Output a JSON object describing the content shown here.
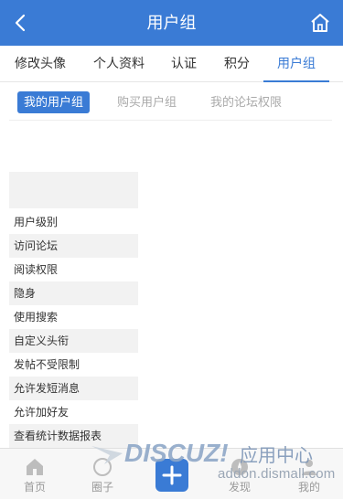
{
  "header": {
    "title": "用户组",
    "back_icon": "chevron-left-icon",
    "home_icon": "home-icon",
    "bg_color": "#3a7bd5"
  },
  "tabs": [
    {
      "label": "修改头像"
    },
    {
      "label": "个人资料"
    },
    {
      "label": "认证"
    },
    {
      "label": "积分"
    },
    {
      "label": "用户组",
      "active": true
    }
  ],
  "subtabs": [
    {
      "label": "我的用户组",
      "active": true
    },
    {
      "label": "购买用户组"
    },
    {
      "label": "我的论坛权限"
    }
  ],
  "permissions": [
    "用户级别",
    "访问论坛",
    "阅读权限",
    "隐身",
    "使用搜索",
    "自定义头衔",
    "发帖不受限制",
    "允许发短消息",
    "允许加好友",
    "查看统计数据报表"
  ],
  "watermark": {
    "logo_text": "DISCUZ!应用中心",
    "url": "addon.dismall.com"
  },
  "bottom_nav": [
    {
      "label": "首页",
      "icon": "home-icon"
    },
    {
      "label": "圈子",
      "icon": "circle-icon"
    },
    {
      "label": "发现",
      "icon": "compass-icon"
    },
    {
      "label": "我的",
      "icon": "user-icon"
    }
  ],
  "post_button_icon": "plus-icon"
}
